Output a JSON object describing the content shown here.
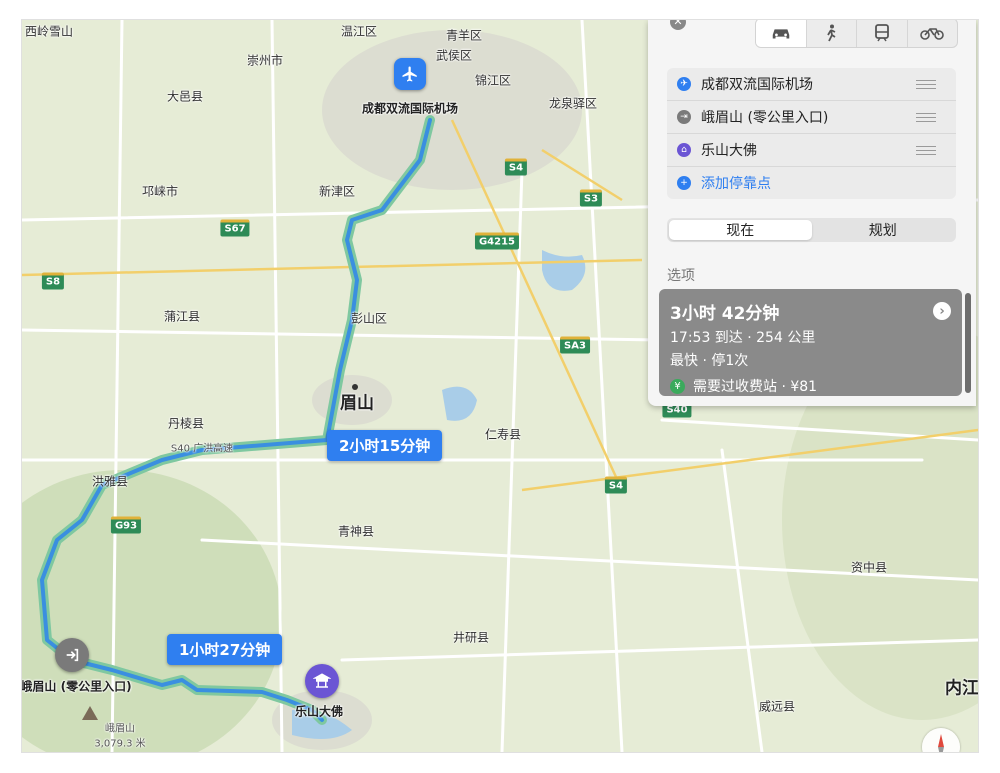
{
  "map": {
    "places": [
      {
        "id": "xiling",
        "text": "西岭雪山"
      },
      {
        "id": "wenjiang",
        "text": "温江区"
      },
      {
        "id": "qingyang",
        "text": "青羊区"
      },
      {
        "id": "wuhou",
        "text": "武侯区"
      },
      {
        "id": "jinjiang",
        "text": "锦江区"
      },
      {
        "id": "chongzhou",
        "text": "崇州市"
      },
      {
        "id": "dayi",
        "text": "大邑县"
      },
      {
        "id": "airport",
        "text": "成都双流国际机场"
      },
      {
        "id": "longquanyi",
        "text": "龙泉驿区"
      },
      {
        "id": "qionglai",
        "text": "邛崃市"
      },
      {
        "id": "xinjin",
        "text": "新津区"
      },
      {
        "id": "pujiang",
        "text": "蒲江县"
      },
      {
        "id": "pengshan",
        "text": "彭山区"
      },
      {
        "id": "meishan",
        "text": "眉山"
      },
      {
        "id": "danleng",
        "text": "丹棱县"
      },
      {
        "id": "renshou",
        "text": "仁寿县"
      },
      {
        "id": "hongya",
        "text": "洪雅县"
      },
      {
        "id": "qingshen",
        "text": "青神县"
      },
      {
        "id": "ziyang",
        "text": "资中县"
      },
      {
        "id": "jingyan",
        "text": "井研县"
      },
      {
        "id": "emei-gate",
        "text": "峨眉山 (零公里入口)"
      },
      {
        "id": "leshan",
        "text": "乐山大佛"
      },
      {
        "id": "weiyuan",
        "text": "威远县"
      },
      {
        "id": "neijiang",
        "text": "内江"
      },
      {
        "id": "emeishan-peak",
        "text": "峨眉山"
      },
      {
        "id": "peak-elev",
        "text": "3,079.3 米"
      },
      {
        "id": "s40-road",
        "text": "S40 广洪高速"
      }
    ],
    "shields": [
      "S4",
      "S3",
      "S67",
      "G4215",
      "S8",
      "SA3",
      "S40",
      "S4",
      "G93"
    ],
    "route_labels": {
      "segment1": "2小时15分钟",
      "segment2": "1小时27分钟"
    },
    "colors": {
      "route": "#3a8fe0",
      "route_casing": "#7fc8a0",
      "pill": "#2f7ff0",
      "land": "#e6ecd6"
    }
  },
  "panel": {
    "modes": [
      "car-icon",
      "walk-icon",
      "transit-icon",
      "bike-icon"
    ],
    "stops": [
      {
        "label": "成都双流国际机场",
        "icon": "plane-icon",
        "color": "#2f7ff0"
      },
      {
        "label": "峨眉山 (零公里入口)",
        "icon": "exit-icon",
        "color": "#7a7a7a"
      },
      {
        "label": "乐山大佛",
        "icon": "temple-icon",
        "color": "#6b55d4"
      }
    ],
    "add_stop": "添加停靠点",
    "time_options": [
      "现在",
      "规划"
    ],
    "options_label": "选项",
    "route": {
      "duration": "3小时 42分钟",
      "arrival": "17:53 到达 · 254 公里",
      "tags": "最快 · 停1次",
      "toll": "需要过收费站 · ¥81"
    }
  }
}
